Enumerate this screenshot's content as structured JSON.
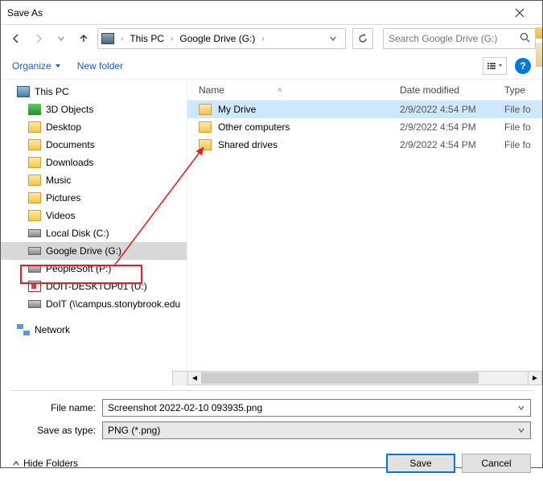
{
  "window": {
    "title": "Save As"
  },
  "nav": {
    "breadcrumb": [
      "This PC",
      "Google Drive (G:)"
    ],
    "search_placeholder": "Search Google Drive (G:)"
  },
  "toolbar": {
    "organize": "Organize",
    "newfolder": "New folder"
  },
  "tree": {
    "items": [
      {
        "label": "This PC",
        "icon": "pc",
        "level": 1
      },
      {
        "label": "3D Objects",
        "icon": "cube",
        "level": 2
      },
      {
        "label": "Desktop",
        "icon": "folder",
        "level": 2
      },
      {
        "label": "Documents",
        "icon": "folder",
        "level": 2
      },
      {
        "label": "Downloads",
        "icon": "folder",
        "level": 2
      },
      {
        "label": "Music",
        "icon": "folder",
        "level": 2
      },
      {
        "label": "Pictures",
        "icon": "folder",
        "level": 2
      },
      {
        "label": "Videos",
        "icon": "folder",
        "level": 2
      },
      {
        "label": "Local Disk (C:)",
        "icon": "drive",
        "level": 2
      },
      {
        "label": "Google Drive (G:)",
        "icon": "drive-g",
        "level": 2,
        "selected": true,
        "highlighted": true
      },
      {
        "label": "PeopleSoft (P:)",
        "icon": "drive",
        "level": 2
      },
      {
        "label": "DOIT-DESKTOP01 (U:)",
        "icon": "doit",
        "level": 2
      },
      {
        "label": "DoIT (\\\\campus.stonybrook.edu",
        "icon": "drive",
        "level": 2
      },
      {
        "label": "",
        "icon": "",
        "level": 0,
        "blank": true
      },
      {
        "label": "Network",
        "icon": "nw",
        "level": 1
      }
    ]
  },
  "columns": {
    "name": "Name",
    "date": "Date modified",
    "type": "Type"
  },
  "rows": [
    {
      "name": "My Drive",
      "date": "2/9/2022 4:54 PM",
      "type": "File fo",
      "selected": true
    },
    {
      "name": "Other computers",
      "date": "2/9/2022 4:54 PM",
      "type": "File fo"
    },
    {
      "name": "Shared drives",
      "date": "2/9/2022 4:54 PM",
      "type": "File fo"
    }
  ],
  "fields": {
    "filename_label": "File name:",
    "filename_value": "Screenshot 2022-02-10 093935.png",
    "type_label": "Save as type:",
    "type_value": "PNG (*.png)"
  },
  "footer": {
    "hide": "Hide Folders",
    "save": "Save",
    "cancel": "Cancel"
  }
}
